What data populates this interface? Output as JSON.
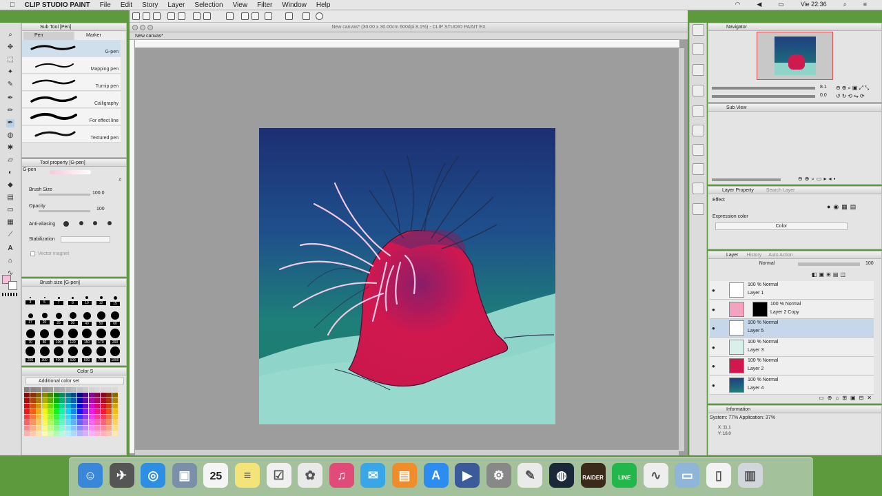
{
  "menubar": {
    "app": "CLIP STUDIO PAINT",
    "items": [
      "File",
      "Edit",
      "Story",
      "Layer",
      "Selection",
      "View",
      "Filter",
      "Window",
      "Help"
    ],
    "clock": "Vie 22:36"
  },
  "subtool": {
    "title": "Sub Tool [Pen]",
    "tabs": [
      "Pen",
      "Marker"
    ],
    "pens": [
      "G-pen",
      "Mapping pen",
      "Turnip pen",
      "Calligraphy",
      "For effect line",
      "Textured pen"
    ]
  },
  "toolprop": {
    "title": "Tool property [G-pen]",
    "name": "G-pen",
    "brush_size_label": "Brush Size",
    "brush_size_value": "100.0",
    "opacity_label": "Opacity",
    "opacity_value": "100",
    "antialias_label": "Anti-aliasing",
    "stabilization_label": "Stabilization",
    "vector_label": "Vector magnet"
  },
  "brushsize": {
    "title": "Brush size [G-pen]",
    "rows": [
      [
        "3",
        "5",
        "7",
        "8",
        "10",
        "12",
        "15"
      ],
      [
        "17",
        "20",
        "25",
        "30",
        "40",
        "50",
        "60"
      ],
      [
        "70",
        "80",
        "100",
        "120",
        "150",
        "170",
        "200"
      ],
      [
        "250",
        "300",
        "400",
        "500",
        "600",
        "700",
        "1000"
      ]
    ]
  },
  "colorset": {
    "tabs": [
      "Color S"
    ],
    "title": "Additional color set"
  },
  "canvas": {
    "window_title": "New canvas* (30.00 x 30.00cm 600dpi 8.1%) - CLIP STUDIO PAINT EX",
    "tab": "New canvas*"
  },
  "navigator": {
    "title": "Navigator",
    "zoom": "8.1",
    "angle": "0.0"
  },
  "subview": {
    "title": "Sub View"
  },
  "layerprop": {
    "tabs": [
      "Layer Property",
      "Search Layer"
    ],
    "effect_label": "Effect",
    "expression_label": "Expression color",
    "expression_value": "Color"
  },
  "layers": {
    "tabs": [
      "Layer",
      "History",
      "Auto Action"
    ],
    "blend": "Normal",
    "opacity": "100",
    "rows": [
      {
        "mode": "100 % Normal",
        "name": "Layer 1",
        "selected": false
      },
      {
        "mode": "100 % Normal",
        "name": "Layer 2 Copy",
        "selected": false
      },
      {
        "mode": "100 % Normal",
        "name": "Layer 5",
        "selected": true
      },
      {
        "mode": "100 % Normal",
        "name": "Layer 3",
        "selected": false
      },
      {
        "mode": "100 % Normal",
        "name": "Layer 2",
        "selected": false
      },
      {
        "mode": "100 % Normal",
        "name": "Layer 4",
        "selected": false
      }
    ]
  },
  "info": {
    "title": "Information",
    "system": "System: 77% Application: 37%",
    "x": "X: 11.1",
    "y": "Y: 16.0"
  },
  "dock": {
    "items": [
      {
        "icon": "finder-icon",
        "color": "#3a86d9"
      },
      {
        "icon": "launchpad-icon",
        "color": "#555"
      },
      {
        "icon": "safari-icon",
        "color": "#2c8fe3"
      },
      {
        "icon": "preview-icon",
        "color": "#7a8fa8"
      },
      {
        "icon": "calendar-icon",
        "color": "#f4f4f4",
        "label": "25"
      },
      {
        "icon": "notes-icon",
        "color": "#f2e479"
      },
      {
        "icon": "reminders-icon",
        "color": "#f0f0f0"
      },
      {
        "icon": "photos-icon",
        "color": "#e9e9e9"
      },
      {
        "icon": "itunes-icon",
        "color": "#e04b7a"
      },
      {
        "icon": "messages-icon",
        "color": "#39a6e8"
      },
      {
        "icon": "ibooks-icon",
        "color": "#f08d2a"
      },
      {
        "icon": "appstore-icon",
        "color": "#2d8cf0"
      },
      {
        "icon": "quicktime-icon",
        "color": "#3a5a9a"
      },
      {
        "icon": "systemprefs-icon",
        "color": "#888"
      },
      {
        "icon": "textedit-icon",
        "color": "#eaeaea"
      },
      {
        "icon": "steam-icon",
        "color": "#1b2838"
      },
      {
        "icon": "tombraider-icon",
        "color": "#3b2a1a",
        "label": "RAIDER"
      },
      {
        "icon": "line-icon",
        "color": "#21b74b",
        "label": "LINE"
      },
      {
        "icon": "clipstudio-icon",
        "color": "#eeeeee"
      },
      {
        "icon": "folder-icon",
        "color": "#8fb6d6"
      },
      {
        "icon": "document-icon",
        "color": "#f2f2f2"
      },
      {
        "icon": "trash-icon",
        "color": "#d0d6dc"
      }
    ]
  }
}
